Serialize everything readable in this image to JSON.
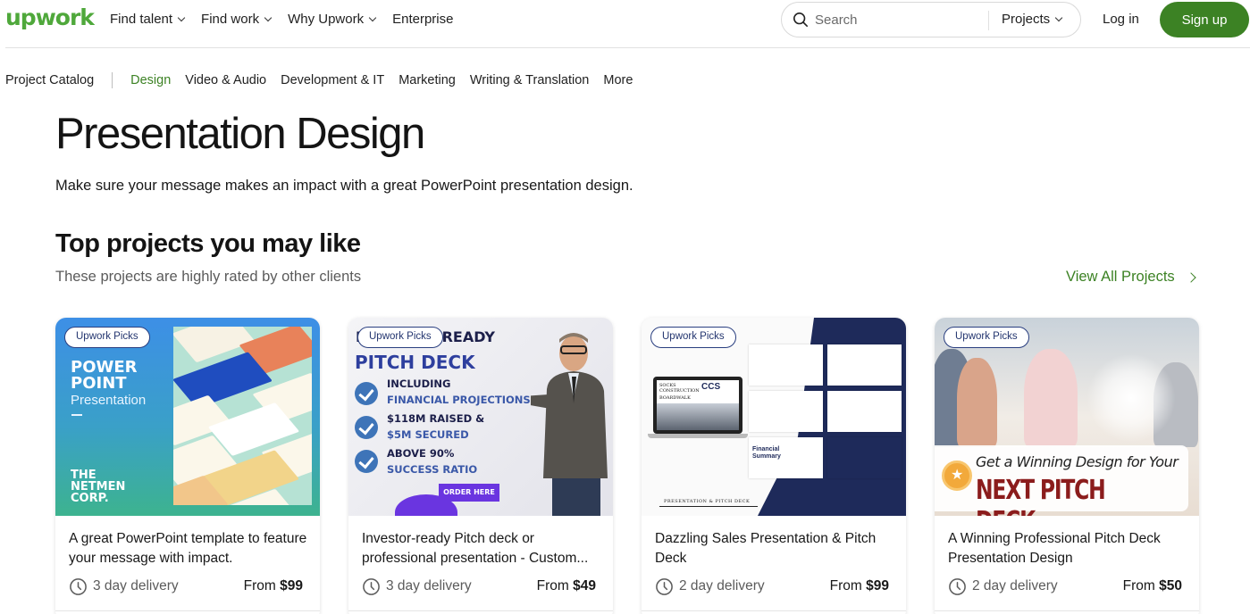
{
  "header": {
    "logo": "upwork",
    "nav": [
      {
        "label": "Find talent",
        "has_dropdown": true
      },
      {
        "label": "Find work",
        "has_dropdown": true
      },
      {
        "label": "Why Upwork",
        "has_dropdown": true
      },
      {
        "label": "Enterprise",
        "has_dropdown": false
      }
    ],
    "search": {
      "placeholder": "Search",
      "value": "",
      "scope": "Projects"
    },
    "login_label": "Log in",
    "signup_label": "Sign up",
    "brand_color": "#3c8224"
  },
  "subnav": {
    "title": "Project Catalog",
    "items": [
      {
        "label": "Design",
        "active": true
      },
      {
        "label": "Video & Audio",
        "active": false
      },
      {
        "label": "Development & IT",
        "active": false
      },
      {
        "label": "Marketing",
        "active": false
      },
      {
        "label": "Writing & Translation",
        "active": false
      },
      {
        "label": "More",
        "active": false
      }
    ]
  },
  "hero": {
    "title": "Presentation Design",
    "description": "Make sure your message makes an impact with a great PowerPoint presentation design."
  },
  "section": {
    "title": "Top projects you may like",
    "subtitle": "These projects are highly rated by other clients",
    "view_all_label": "View All Projects"
  },
  "cards": [
    {
      "badge": "Upwork Picks",
      "thumb": {
        "line1": "POWER",
        "line2": "POINT",
        "line3": "Presentation",
        "corp1": "THE",
        "corp2": "NETMEN",
        "corp3": "CORP."
      },
      "title": "A great PowerPoint template to feature your message with impact.",
      "delivery": "3 day delivery",
      "price_prefix": "From",
      "price": "$99"
    },
    {
      "badge": "Upwork Picks",
      "thumb": {
        "h1": "INVESTOR READY",
        "h2": "PITCH DECK",
        "b1a": "INCLUDING",
        "b1b": "FINANCIAL PROJECTIONS",
        "b2a": "$118M RAISED &",
        "b2b": "$5M SECURED",
        "b3a": "ABOVE 90%",
        "b3b": "SUCCESS RATIO",
        "cta": "ORDER HERE"
      },
      "title": "Investor-ready Pitch deck or professional presentation - Custom...",
      "delivery": "3 day delivery",
      "price_prefix": "From",
      "price": "$49"
    },
    {
      "badge": "Upwork Picks",
      "thumb": {
        "footer": "PRESENTATION & PITCH DECK",
        "fin": "Financial Summary",
        "brand": "SOCKS CONSTRUCTION",
        "brand2": "CCS",
        "sub": "BOARDWALK"
      },
      "title": "Dazzling Sales Presentation & Pitch Deck",
      "delivery": "2 day delivery",
      "price_prefix": "From",
      "price": "$99"
    },
    {
      "badge": "Upwork Picks",
      "thumb": {
        "line1": "Get a Winning Design for Your",
        "line2": "NEXT PITCH DECK"
      },
      "title": "A Winning Professional Pitch Deck Presentation Design",
      "delivery": "2 day delivery",
      "price_prefix": "From",
      "price": "$50"
    }
  ]
}
